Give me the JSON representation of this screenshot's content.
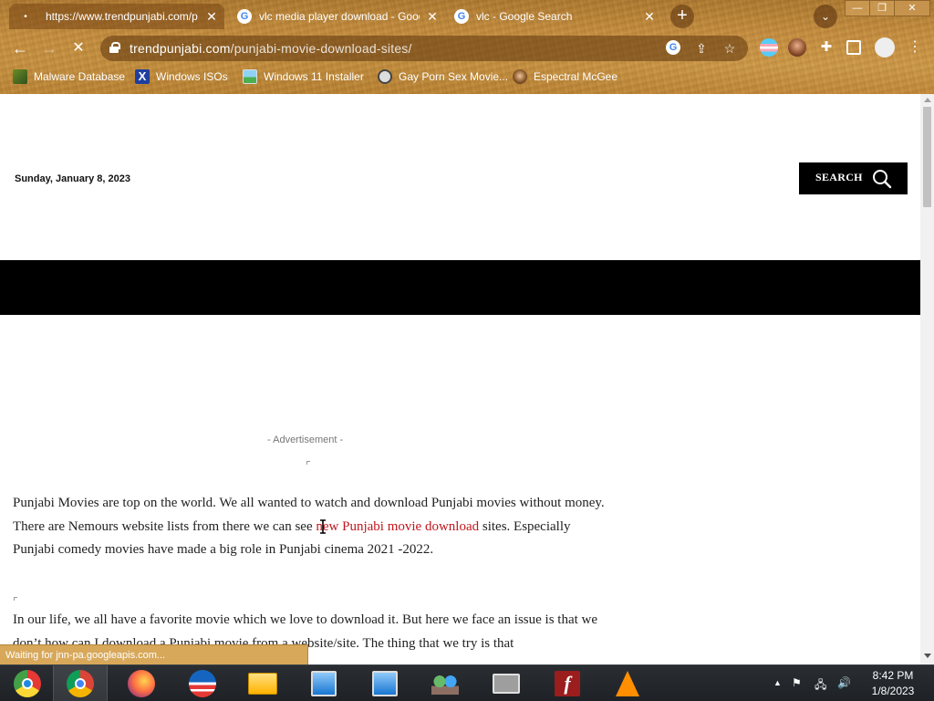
{
  "browser": {
    "tabs": [
      {
        "title": "https://www.trendpunjabi.com/p",
        "active": true
      },
      {
        "title": "vlc media player download - Google",
        "active": false
      },
      {
        "title": "vlc - Google Search",
        "active": false
      }
    ],
    "new_tab_label": "+",
    "url_host": "trendpunjabi.com",
    "url_path": "/punjabi-movie-download-sites/",
    "bookmarks": [
      {
        "label": "Malware Database",
        "icon": "malware-db-icon"
      },
      {
        "label": "Windows ISOs",
        "icon": "x-logo-icon"
      },
      {
        "label": "Windows 11 Installer",
        "icon": "image-icon"
      },
      {
        "label": "Gay Porn Sex Movie...",
        "icon": "globe-icon"
      },
      {
        "label": "Espectral McGee",
        "icon": "character-icon"
      }
    ],
    "status_text": "Waiting for jnn-pa.googleapis.com..."
  },
  "page": {
    "date": "Sunday, January 8, 2023",
    "search_label": "SEARCH",
    "ad_label": "- Advertisement -",
    "para1_before": "Punjabi Movies are top on the world. We all wanted to watch and download Punjabi movies without money. There are Nemours website lists from there we can see ",
    "para1_link": "new Punjabi movie download",
    "para1_after": " sites. Especially Punjabi comedy movies have made a big role in Punjabi cinema 2021 -2022.",
    "para2": "In our life, we all have a favorite movie which we love to download it. But here we face an issue is that we don’t how can I download a Punjabi movie from a website/site. The thing that we try is that"
  },
  "taskbar": {
    "apps": [
      "chromium-icon",
      "chrome-icon",
      "firefox-icon",
      "obama-icon",
      "file-explorer-icon",
      "network-setup-icon",
      "network-setup-2-icon",
      "people-network-icon",
      "printer-icon",
      "flash-icon",
      "vlc-icon"
    ],
    "time": "8:42 PM",
    "date": "1/8/2023"
  },
  "colors": {
    "link": "#c2161c",
    "chrome_bg": "#c48a39",
    "taskbar": "#1e2226"
  }
}
